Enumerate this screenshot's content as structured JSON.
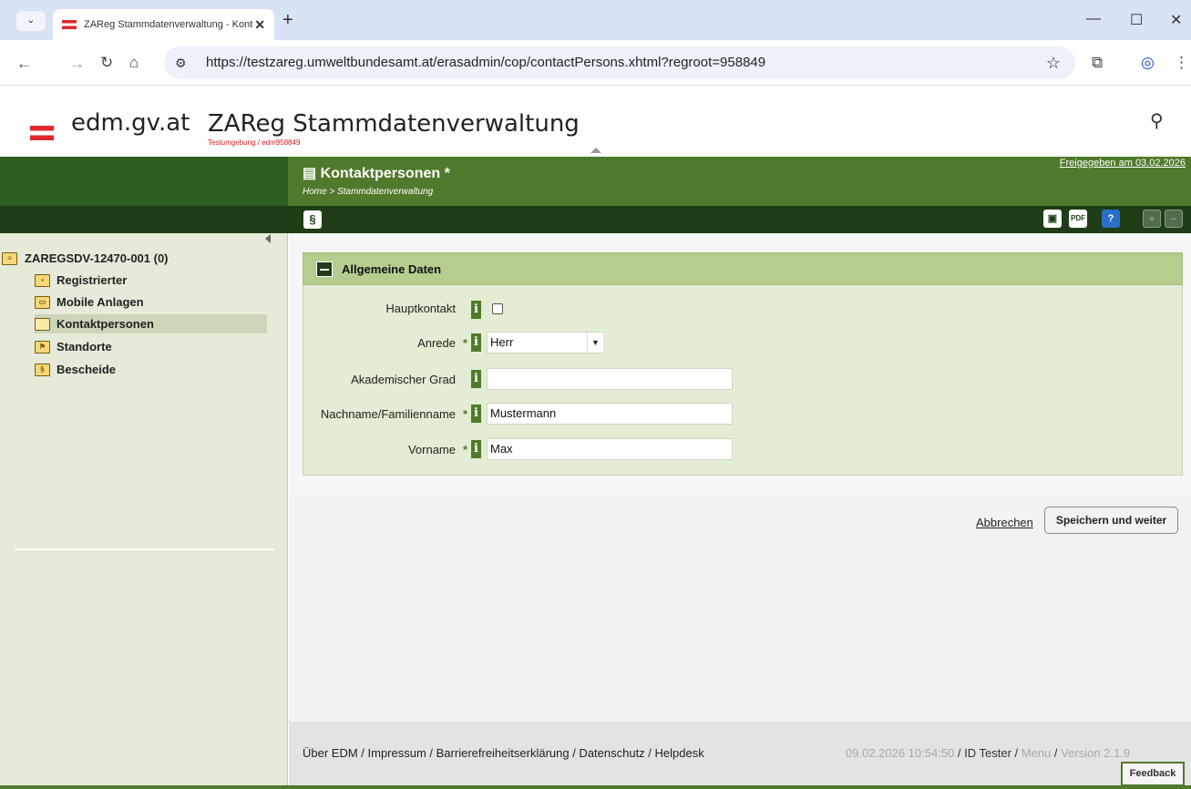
{
  "browser": {
    "tab_title": "ZAReg Stammdatenverwaltung - Kont",
    "tab_close": "✕",
    "new_tab": "+",
    "tab_dropdown": "⌄",
    "url": "https://testzareg.umweltbundesamt.at/erasadmin/cop/contactPersons.xhtml?regroot=958849",
    "win_minimize": "—",
    "win_maximize": "☐",
    "win_close": "✕"
  },
  "site": {
    "logo_text": "edm.gv.at",
    "app_title": "ZAReg Stammdatenverwaltung",
    "env_label": "Testumgebung / edm958849"
  },
  "header": {
    "page_title": "Kontaktpersonen *",
    "breadcrumb": "Home > Stammdatenverwaltung",
    "released": "Freigegeben am 03.02.2026",
    "paragraph_icon": "§"
  },
  "sidebar": {
    "root": "ZAREGSDV-12470-001 (0)",
    "items": [
      {
        "label": "Registrierter",
        "icon": "person-folder-icon"
      },
      {
        "label": "Mobile Anlagen",
        "icon": "truck-folder-icon"
      },
      {
        "label": "Kontaktpersonen",
        "icon": "folder-open-icon"
      },
      {
        "label": "Standorte",
        "icon": "flag-folder-icon"
      },
      {
        "label": "Bescheide",
        "icon": "document-folder-icon"
      }
    ]
  },
  "panel": {
    "title": "Allgemeine Daten",
    "fields": {
      "hauptkontakt_label": "Hauptkontakt",
      "anrede_label": "Anrede",
      "anrede_value": "Herr",
      "grad_label": "Akademischer Grad",
      "grad_value": "",
      "nachname_label": "Nachname/Familienname",
      "nachname_value": "Mustermann",
      "vorname_label": "Vorname",
      "vorname_value": "Max"
    },
    "required_marker": "*",
    "info_marker": "i"
  },
  "actions": {
    "cancel": "Abbrechen",
    "save": "Speichern und weiter"
  },
  "footer": {
    "links": "Über EDM  /  Impressum  /  Barrierefreiheitserklärung  /  Datenschutz  /  Helpdesk",
    "timestamp": "09.02.2026 10:54:50",
    "user": "ID Tester",
    "menu": "Menu",
    "version": "Version 2.1.9",
    "sep": " / ",
    "feedback": "Feedback"
  },
  "colors": {
    "green_dark": "#1f3d16",
    "green": "#4f7a2b",
    "panel_bg": "#e3ecd4",
    "panel_head": "#b5cd8e"
  }
}
